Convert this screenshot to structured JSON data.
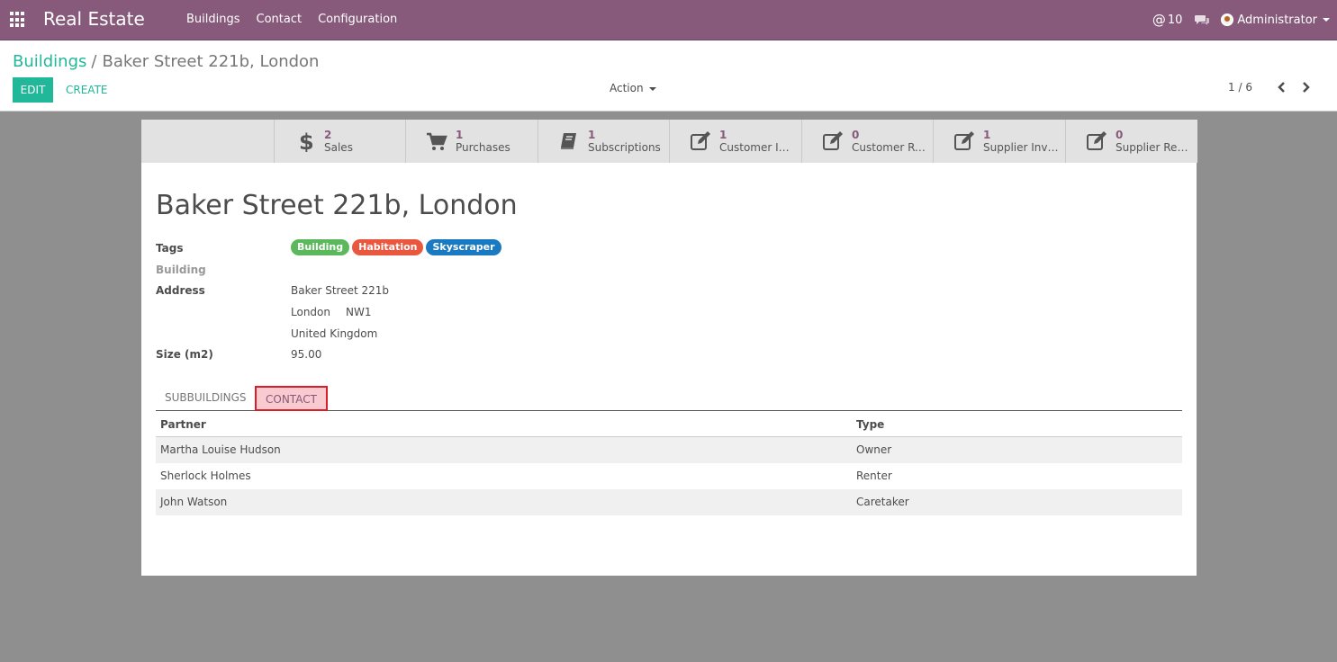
{
  "navbar": {
    "brand": "Real Estate",
    "menu": [
      "Buildings",
      "Contact",
      "Configuration"
    ],
    "mentions_count": "10",
    "user": "Administrator"
  },
  "control_panel": {
    "breadcrumb_parent": "Buildings",
    "breadcrumb_separator": "/",
    "breadcrumb_current": "Baker Street 221b, London",
    "edit_label": "EDIT",
    "create_label": "CREATE",
    "action_label": "Action",
    "pager": "1 / 6"
  },
  "stat_buttons": [
    {
      "icon": "dollar-icon",
      "value": "2",
      "label": "Sales"
    },
    {
      "icon": "shopping-cart-icon",
      "value": "1",
      "label": "Purchases"
    },
    {
      "icon": "book-icon",
      "value": "1",
      "label": "Subscriptions"
    },
    {
      "icon": "edit-icon",
      "value": "1",
      "label": "Customer Invoices"
    },
    {
      "icon": "edit-icon",
      "value": "0",
      "label": "Customer Refunds"
    },
    {
      "icon": "edit-icon",
      "value": "1",
      "label": "Supplier Invoices"
    },
    {
      "icon": "edit-icon",
      "value": "0",
      "label": "Supplier Refunds"
    }
  ],
  "record": {
    "title": "Baker Street 221b, London",
    "tags_label": "Tags",
    "tags": [
      {
        "name": "Building",
        "color": "#5cb85c"
      },
      {
        "name": "Habitation",
        "color": "#e9573f"
      },
      {
        "name": "Skyscraper",
        "color": "#1a7ac1"
      }
    ],
    "building_label": "Building",
    "address_label": "Address",
    "street": "Baker Street 221b",
    "city": "London",
    "zip": "NW1",
    "country": "United Kingdom",
    "size_label": "Size (m2)",
    "size_value": "95.00"
  },
  "tabs": [
    {
      "label": "SUBBUILDINGS",
      "active": false
    },
    {
      "label": "CONTACT",
      "active": true
    }
  ],
  "contacts_table": {
    "columns": [
      "Partner",
      "Type"
    ],
    "rows": [
      [
        "Martha Louise Hudson",
        "Owner"
      ],
      [
        "Sherlock Holmes",
        "Renter"
      ],
      [
        "John Watson",
        "Caretaker"
      ]
    ]
  },
  "colors": {
    "navbar": "#875a7b",
    "accent": "#21b799",
    "highlight_border": "#d61f29"
  }
}
